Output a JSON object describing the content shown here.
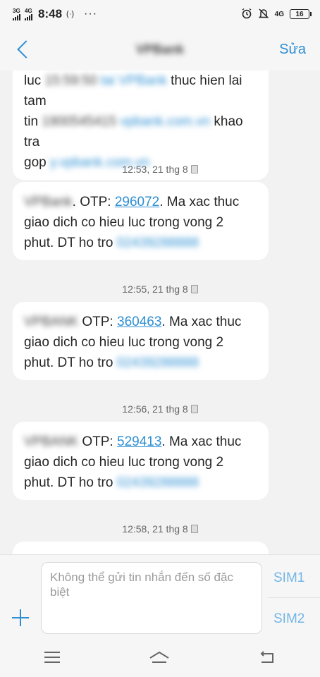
{
  "status_bar": {
    "network1": "3G",
    "network2": "4G",
    "time": "8:48",
    "nfc": "(·)",
    "more": "···",
    "network_right": "4G",
    "battery": "16"
  },
  "header": {
    "title": "VPBank",
    "edit_label": "Sửa"
  },
  "messages": [
    {
      "type": "bubble",
      "lines": [
        [
          {
            "t": "luc ",
            "s": "plain"
          },
          {
            "t": "15:59:50",
            "s": "blur"
          },
          {
            "t": " ",
            "s": "plain"
          },
          {
            "t": "tai VPBank",
            "s": "blur-link"
          },
          {
            "t": " thuc hien lai tam",
            "s": "plain"
          }
        ],
        [
          {
            "t": "tin",
            "s": "plain"
          },
          {
            "t": " 1900545415",
            "s": "blur"
          },
          {
            "t": " ",
            "s": "plain"
          },
          {
            "t": "vpbank.com.vn",
            "s": "blur-link"
          },
          {
            "t": " khao tra",
            "s": "plain"
          }
        ],
        [
          {
            "t": "gop ",
            "s": "plain"
          },
          {
            "t": "y.vpbank.com.vn",
            "s": "blur-link"
          }
        ]
      ]
    },
    {
      "type": "timestamp",
      "text": "12:53, 21 thg 8"
    },
    {
      "type": "bubble",
      "lines": [
        [
          {
            "t": "VPBank",
            "s": "blur"
          },
          {
            "t": ". OTP: ",
            "s": "plain"
          },
          {
            "t": "296072",
            "s": "link"
          },
          {
            "t": ". Ma xac thuc",
            "s": "plain"
          }
        ],
        [
          {
            "t": "giao dich co hieu luc trong vong 2",
            "s": "plain"
          }
        ],
        [
          {
            "t": "phut. DT ho tro ",
            "s": "plain"
          },
          {
            "t": "02439288888",
            "s": "blur-link"
          }
        ]
      ]
    },
    {
      "type": "timestamp",
      "text": "12:55, 21 thg 8"
    },
    {
      "type": "bubble",
      "lines": [
        [
          {
            "t": "VPBANK",
            "s": "blur"
          },
          {
            "t": " OTP: ",
            "s": "plain"
          },
          {
            "t": "360463",
            "s": "link"
          },
          {
            "t": ". Ma xac thuc",
            "s": "plain"
          }
        ],
        [
          {
            "t": "giao dich co hieu luc trong vong 2",
            "s": "plain"
          }
        ],
        [
          {
            "t": "phut. DT ho tro ",
            "s": "plain"
          },
          {
            "t": "02439288888",
            "s": "blur-link"
          }
        ]
      ]
    },
    {
      "type": "timestamp",
      "text": "12:56, 21 thg 8"
    },
    {
      "type": "bubble",
      "lines": [
        [
          {
            "t": "VPBANK",
            "s": "blur"
          },
          {
            "t": " OTP: ",
            "s": "plain"
          },
          {
            "t": "529413",
            "s": "link"
          },
          {
            "t": ". Ma xac thuc",
            "s": "plain"
          }
        ],
        [
          {
            "t": "giao dich co hieu luc trong vong 2",
            "s": "plain"
          }
        ],
        [
          {
            "t": "phut. DT ho tro ",
            "s": "plain"
          },
          {
            "t": "02439288888",
            "s": "blur-link"
          }
        ]
      ]
    },
    {
      "type": "timestamp",
      "text": "12:58, 21 thg 8"
    }
  ],
  "composer": {
    "placeholder": "Không thể gửi tin nhắn đến số đặc biệt",
    "sim1_label": "SIM1",
    "sim2_label": "SIM2"
  },
  "colors": {
    "accent": "#2d8fd3",
    "background": "#f2f2f2",
    "bubble": "#ffffff"
  },
  "icons": {
    "back": "chevron-left-icon",
    "add": "plus-icon",
    "menu": "menu-icon",
    "home": "home-icon",
    "nav_back": "back-arrow-icon",
    "alarm": "alarm-icon",
    "mute": "bell-off-icon"
  }
}
